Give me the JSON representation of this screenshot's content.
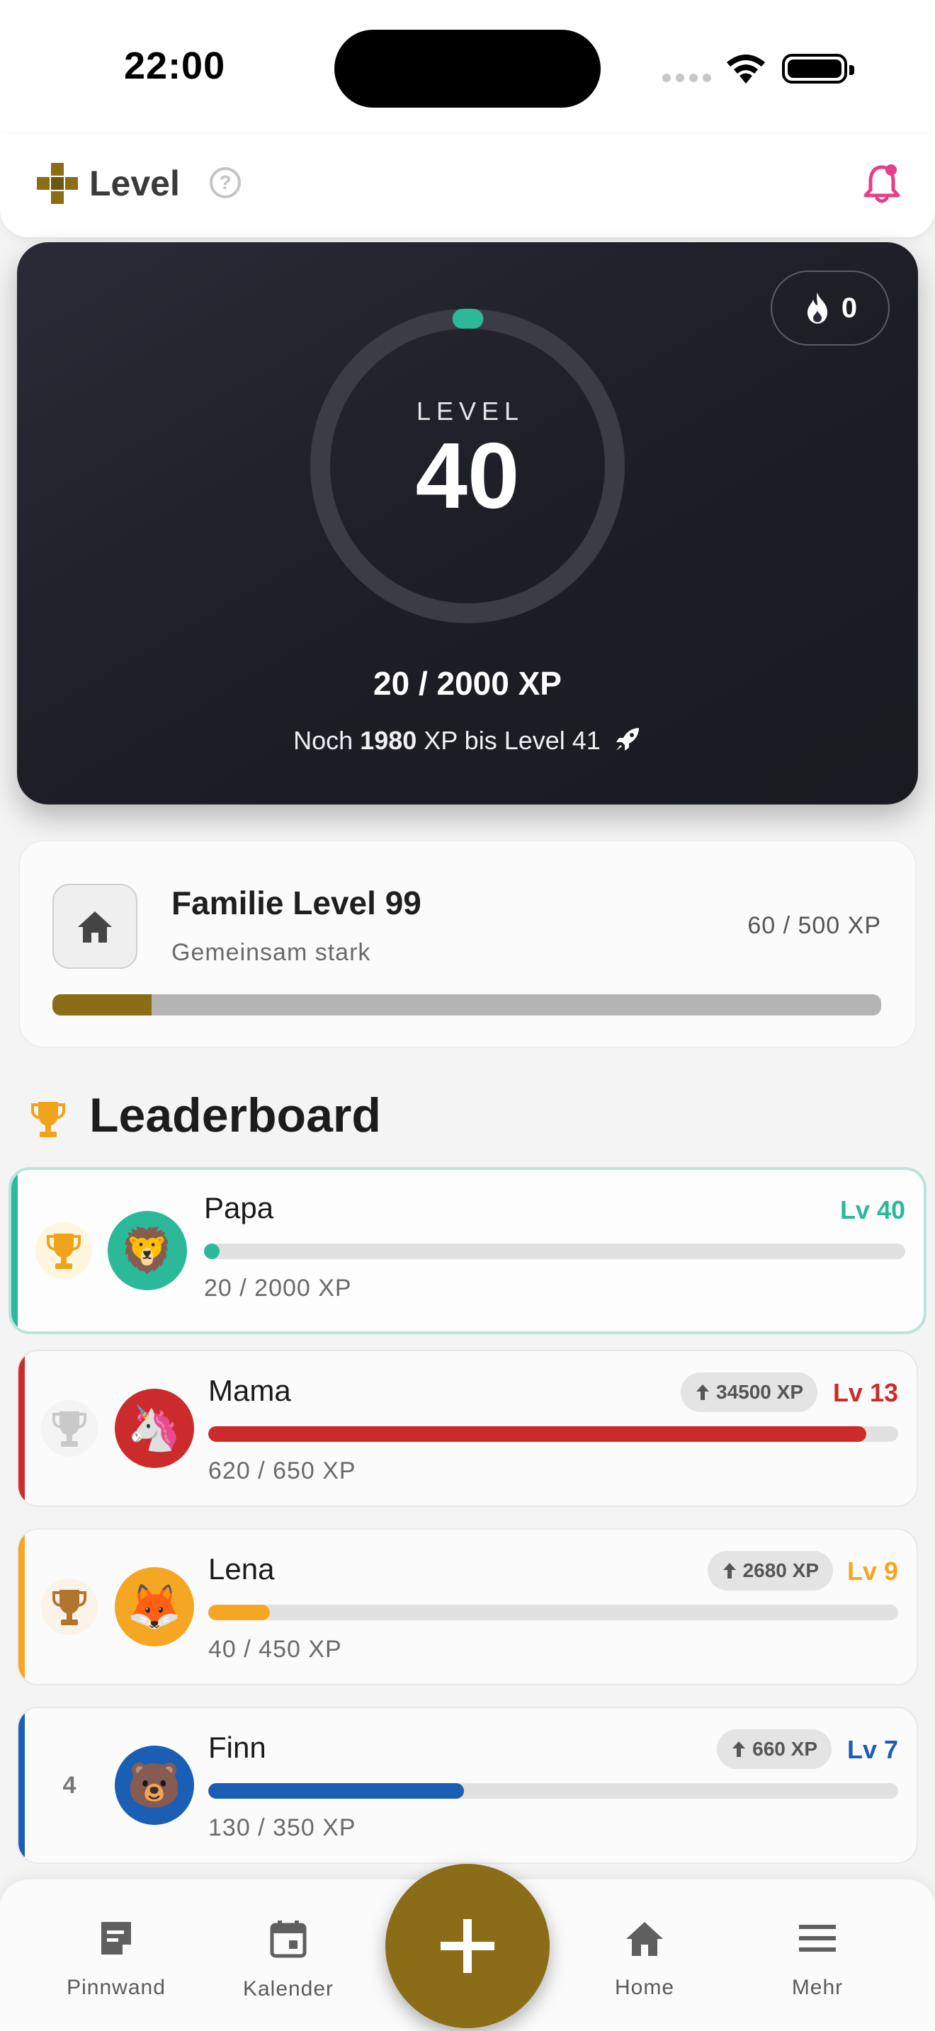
{
  "status_bar": {
    "time": "22:00"
  },
  "header": {
    "title": "Level",
    "help_icon": "question-circle-icon",
    "bell_icon": "bell-alert-icon"
  },
  "hero": {
    "streak_value": "0",
    "level_caption": "LEVEL",
    "level": "40",
    "xp_total": "20 / 2000 XP",
    "remaining_prefix": "Noch ",
    "remaining_value": "1980",
    "remaining_suffix": " XP bis Level 41",
    "progress_fraction": 0.01,
    "accent": "#2bb99a"
  },
  "family": {
    "title": "Familie Level 99",
    "subtitle": "Gemeinsam stark",
    "xp": "60 / 500 XP",
    "progress_fraction": 0.12,
    "color": "#8b6c17"
  },
  "leaderboard": {
    "title": "Leaderboard",
    "members": [
      {
        "rank": "1",
        "name": "Papa",
        "level": "Lv 40",
        "gap": "",
        "xp": "20 / 2000 XP",
        "progress": 0.01,
        "color": "#2bb99a",
        "avatar": "🦁",
        "highlight": true
      },
      {
        "rank": "2",
        "name": "Mama",
        "level": "Lv 13",
        "gap": "34500 XP",
        "xp": "620 / 650 XP",
        "progress": 0.954,
        "color": "#cc2b2b",
        "avatar": "🦄",
        "highlight": false
      },
      {
        "rank": "3",
        "name": "Lena",
        "level": "Lv 9",
        "gap": "2680 XP",
        "xp": "40 / 450 XP",
        "progress": 0.089,
        "color": "#f5a623",
        "avatar": "🦊",
        "highlight": false
      },
      {
        "rank": "4",
        "name": "Finn",
        "level": "Lv 7",
        "gap": "660 XP",
        "xp": "130 / 350 XP",
        "progress": 0.371,
        "color": "#1a5fb4",
        "avatar": "🐻",
        "highlight": false
      }
    ]
  },
  "nav": {
    "items": [
      {
        "label": "Pinnwand",
        "icon": "note-icon"
      },
      {
        "label": "Kalender",
        "icon": "calendar-icon"
      },
      {
        "label": "Home",
        "icon": "home-icon"
      },
      {
        "label": "Mehr",
        "icon": "menu-icon"
      }
    ],
    "fab_icon": "plus-icon",
    "fab_color": "#8b6c17"
  }
}
